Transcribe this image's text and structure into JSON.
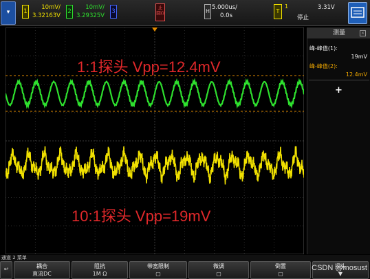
{
  "topbar": {
    "menu_icon": "menu-arrow-icon",
    "ch1": {
      "num": "1",
      "scale": "10mV/",
      "offset": "3.32163V",
      "color": "#f0e000"
    },
    "ch2": {
      "num": "2",
      "scale": "10mV/",
      "offset": "3.29325V",
      "color": "#2ee02e"
    },
    "ch3": {
      "num": "3"
    },
    "stop_badge": "止回Ω",
    "h_marker": "H",
    "timebase": "5.000us/",
    "delay": "0.0s",
    "trig_badge": "T",
    "trig_num": "1",
    "trig_level": "3.31V",
    "run_state": "停止",
    "right_icon": "display-settings-icon"
  },
  "side_panel": {
    "title": "测量",
    "m1_label": "峰-峰值(1):",
    "m1_value": "19mV",
    "m2_label": "峰-峰值(2):",
    "m2_value": "12.4mV",
    "add_icon": "plus-icon"
  },
  "annotations": {
    "top": "1:1探头 Vpp=12.4mV",
    "bottom": "10:1探头 Vpp=19mV"
  },
  "status_bar": "通道 2 菜单",
  "softkeys": [
    {
      "line1": "耦合",
      "line2": "直流DC"
    },
    {
      "line1": "阻抗",
      "line2": "1M Ω"
    },
    {
      "line1": "带宽限制",
      "line2": ""
    },
    {
      "line1": "微调",
      "line2": ""
    },
    {
      "line1": "倒置",
      "line2": ""
    },
    {
      "line1": "探头",
      "line2": ""
    }
  ],
  "watermark": "CSDN @mosust",
  "colors": {
    "ch1": "#f0e000",
    "ch2": "#2ee02e",
    "annotation": "#e0282a",
    "cursor": "#e08a00"
  }
}
